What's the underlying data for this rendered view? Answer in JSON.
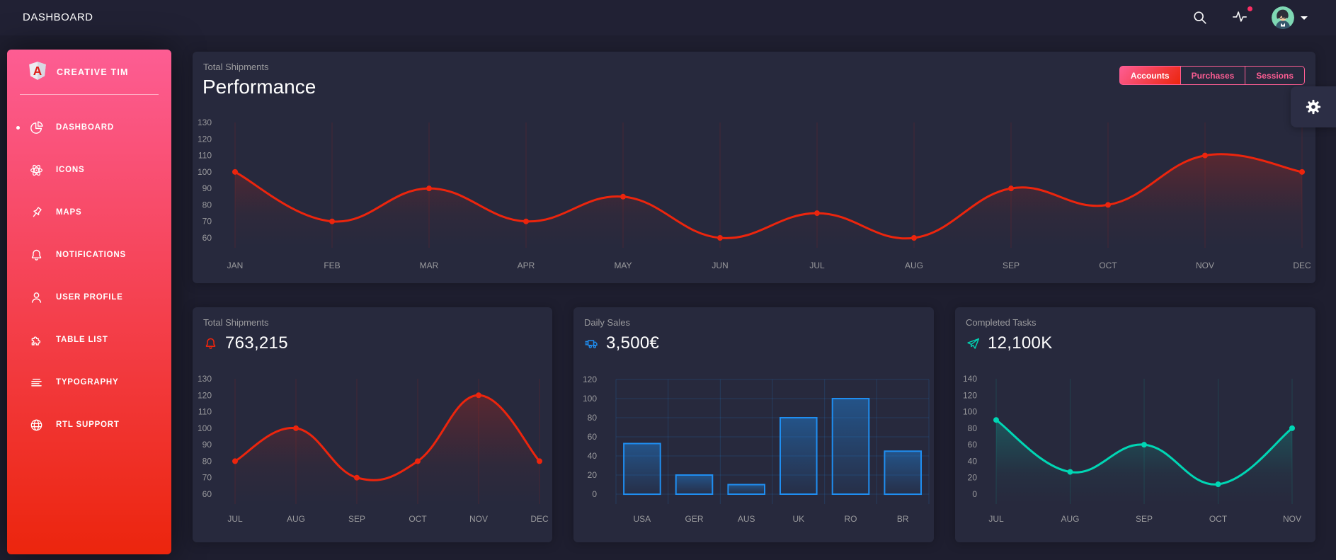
{
  "navbar": {
    "title": "DASHBOARD",
    "icons": [
      "search-icon",
      "activity-icon",
      "avatar"
    ],
    "has_notification_dot": true
  },
  "sidebar": {
    "brand": "CREATIVE TIM",
    "active_item": "DASHBOARD",
    "items": [
      {
        "label": "DASHBOARD",
        "icon": "chart-pie-icon",
        "active": true
      },
      {
        "label": "ICONS",
        "icon": "atom-icon",
        "active": false
      },
      {
        "label": "MAPS",
        "icon": "pin-icon",
        "active": false
      },
      {
        "label": "NOTIFICATIONS",
        "icon": "bell-icon",
        "active": false
      },
      {
        "label": "USER PROFILE",
        "icon": "user-icon",
        "active": false
      },
      {
        "label": "TABLE LIST",
        "icon": "puzzle-icon",
        "active": false
      },
      {
        "label": "TYPOGRAPHY",
        "icon": "align-text-icon",
        "active": false
      },
      {
        "label": "RTL SUPPORT",
        "icon": "globe-icon",
        "active": false
      }
    ]
  },
  "performance_card": {
    "category": "Total Shipments",
    "title": "Performance",
    "active_tab": "Accounts",
    "tabs": [
      {
        "label": "Accounts",
        "active": true
      },
      {
        "label": "Purchases",
        "active": false
      },
      {
        "label": "Sessions",
        "active": false
      }
    ]
  },
  "stat_cards": [
    {
      "category": "Total Shipments",
      "value": "763,215",
      "icon": "bell-icon",
      "icon_color": "#ec250d"
    },
    {
      "category": "Daily Sales",
      "value": "3,500€",
      "icon": "delivery-truck-icon",
      "icon_color": "#1f8ef1"
    },
    {
      "category": "Completed Tasks",
      "value": "12,100K",
      "icon": "send-icon",
      "icon_color": "#00d6b4"
    }
  ],
  "settings": {
    "icon": "gear-icon"
  },
  "colors": {
    "background": "#1e1e2f",
    "card": "#27293d",
    "sidebar_gradient_top": "#fd5d93",
    "sidebar_gradient_bottom": "#ec250d",
    "accent_red": "#ec250d",
    "accent_pink": "#fd5d93",
    "accent_blue": "#1f8ef1",
    "accent_teal": "#00d6b4",
    "notification_dot": "#fb2e63",
    "muted_text": "#9a9a9d",
    "avatar_bg": "#7fd8b4"
  },
  "chart_data": [
    {
      "type": "line",
      "title": "Performance",
      "categories": [
        "JAN",
        "FEB",
        "MAR",
        "APR",
        "MAY",
        "JUN",
        "JUL",
        "AUG",
        "SEP",
        "OCT",
        "NOV",
        "DEC"
      ],
      "values": [
        100,
        70,
        90,
        70,
        85,
        60,
        75,
        60,
        90,
        80,
        110,
        100
      ],
      "ylim": [
        60,
        130
      ],
      "ystep": 10,
      "color": "#ec250d",
      "grid": "vertical",
      "grid_color": "rgba(233,32,16,0.15)",
      "legend_position": "none"
    },
    {
      "type": "line",
      "title": "Total Shipments",
      "categories": [
        "JUL",
        "AUG",
        "SEP",
        "OCT",
        "NOV",
        "DEC"
      ],
      "values": [
        80,
        100,
        70,
        80,
        120,
        80
      ],
      "ylim": [
        60,
        130
      ],
      "ystep": 10,
      "color": "#ec250d",
      "grid": "vertical",
      "grid_color": "rgba(233,32,16,0.15)",
      "legend_position": "none"
    },
    {
      "type": "bar",
      "title": "Daily Sales",
      "categories": [
        "USA",
        "GER",
        "AUS",
        "UK",
        "RO",
        "BR"
      ],
      "values": [
        53,
        20,
        10,
        80,
        100,
        45
      ],
      "ylim": [
        0,
        120
      ],
      "ystep": 20,
      "color": "#1f8ef1",
      "grid": "both",
      "grid_color": "rgba(31,142,241,0.18)",
      "legend_position": "none"
    },
    {
      "type": "line",
      "title": "Completed Tasks",
      "categories": [
        "JUL",
        "AUG",
        "SEP",
        "OCT",
        "NOV"
      ],
      "values": [
        90,
        27,
        60,
        12,
        80
      ],
      "ylim": [
        0,
        140
      ],
      "ystep": 20,
      "color": "#00d6b4",
      "grid": "vertical",
      "grid_color": "rgba(0,214,180,0.15)",
      "legend_position": "none"
    }
  ]
}
